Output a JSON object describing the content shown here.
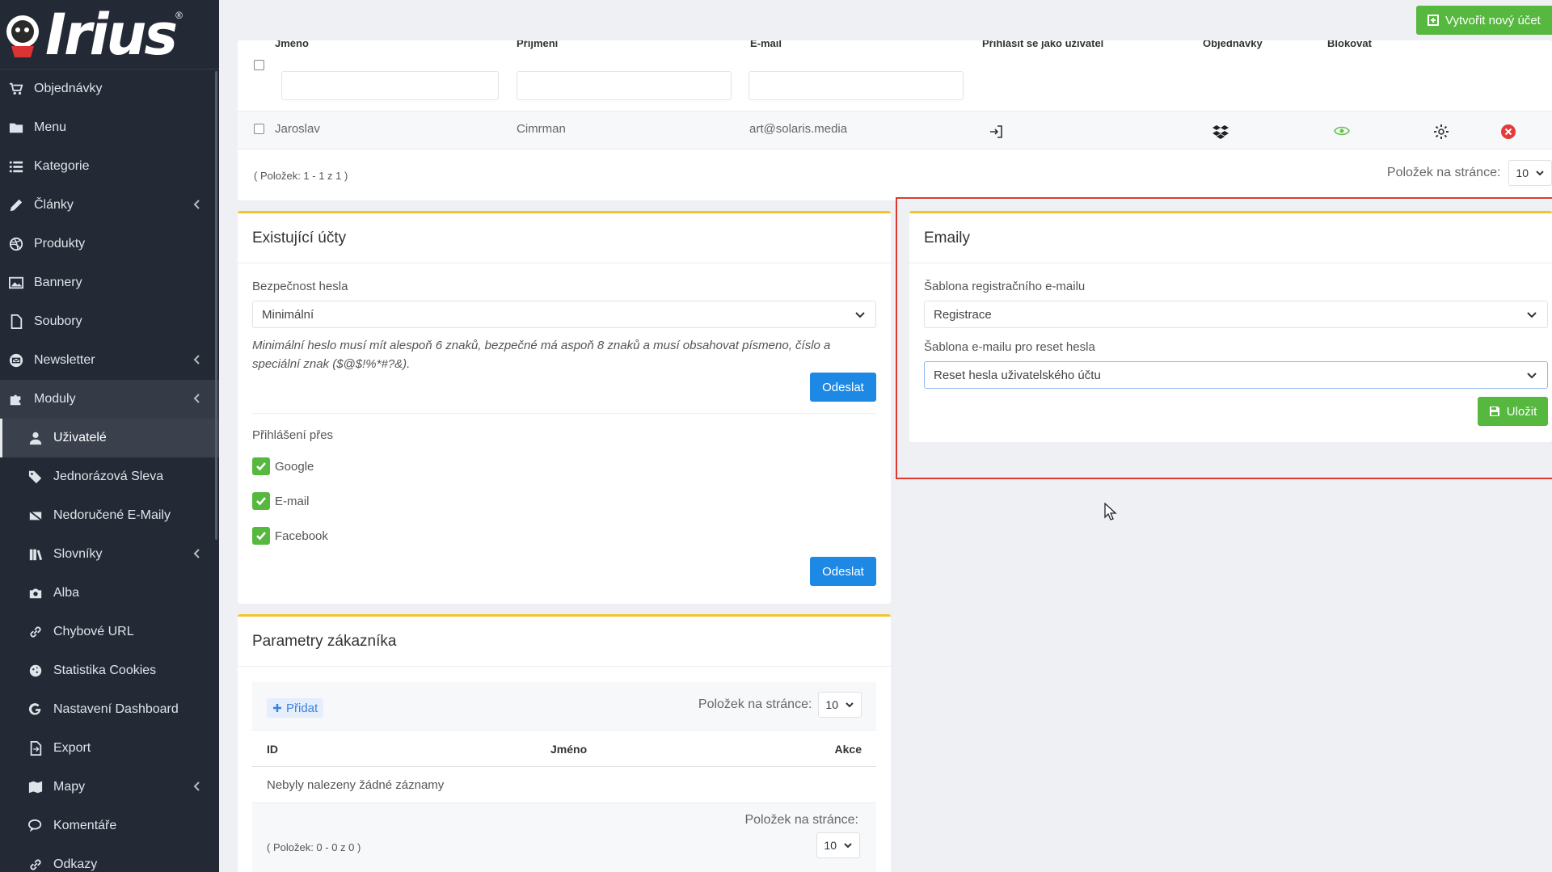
{
  "brand": {
    "name": "Irius",
    "mark": "®"
  },
  "sidebar": {
    "items": [
      {
        "label": "Objednávky",
        "icon": "cart-icon"
      },
      {
        "label": "Menu",
        "icon": "folder-icon"
      },
      {
        "label": "Kategorie",
        "icon": "list-icon"
      },
      {
        "label": "Články",
        "icon": "pencil-icon",
        "chevron": true
      },
      {
        "label": "Produkty",
        "icon": "dribbble-icon"
      },
      {
        "label": "Bannery",
        "icon": "image-icon"
      },
      {
        "label": "Soubory",
        "icon": "file-icon"
      },
      {
        "label": "Newsletter",
        "icon": "mail-icon",
        "chevron": true
      },
      {
        "label": "Moduly",
        "icon": "puzzle-icon",
        "chevron": true
      },
      {
        "label": "Uživatelé",
        "icon": "user-icon"
      },
      {
        "label": "Jednorázová Sleva",
        "icon": "tag-icon"
      },
      {
        "label": "Nedoručené E-Maily",
        "icon": "mail-slash-icon"
      },
      {
        "label": "Slovníky",
        "icon": "books-icon",
        "chevron": true
      },
      {
        "label": "Alba",
        "icon": "camera-icon"
      },
      {
        "label": "Chybové URL",
        "icon": "link-icon"
      },
      {
        "label": "Statistika Cookies",
        "icon": "cookie-icon"
      },
      {
        "label": "Nastavení Dashboard",
        "icon": "google-icon"
      },
      {
        "label": "Export",
        "icon": "export-icon"
      },
      {
        "label": "Mapy",
        "icon": "map-icon",
        "chevron": true
      },
      {
        "label": "Komentáře",
        "icon": "comments-icon"
      },
      {
        "label": "Odkazy",
        "icon": "link-icon"
      }
    ]
  },
  "topbar": {
    "create_label": "Vytvořit nový účet"
  },
  "users_table": {
    "headers": [
      "Jméno",
      "Příjmení",
      "E-mail",
      "Přihlásit se jako uživatel",
      "Objednávky",
      "Blokovat"
    ],
    "rows": [
      {
        "first": "Jaroslav",
        "last": "Cimrman",
        "email": "art@solaris.media"
      }
    ],
    "info": "( Položek: 1 - 1 z 1 )",
    "per_page_label": "Položek na stránce:",
    "per_page_value": "10"
  },
  "accounts": {
    "title": "Existující účty",
    "password_label": "Bezpečnost hesla",
    "password_value": "Minimální",
    "password_hint": "Minimální heslo musí mít alespoň 6 znaků, bezpečné má aspoň 8 znaků a musí obsahovat písmeno, číslo a speciální znak ($@$!%*#?&).",
    "submit_label": "Odeslat",
    "login_label": "Přihlášení přes",
    "login_options": [
      "Google",
      "E-mail",
      "Facebook"
    ],
    "submit2_label": "Odeslat"
  },
  "emails": {
    "title": "Emaily",
    "reg_label": "Šablona registračního e-mailu",
    "reg_value": "Registrace",
    "reset_label": "Šablona e-mailu pro reset hesla",
    "reset_value": "Reset hesla uživatelského účtu",
    "save_label": "Uložit"
  },
  "params": {
    "title": "Parametry zákazníka",
    "add_label": "Přidat",
    "per_page_label": "Položek na stránce:",
    "per_page_value": "10",
    "headers": [
      "ID",
      "Jméno",
      "Akce"
    ],
    "empty": "Nebyly nalezeny žádné záznamy",
    "info": "( Položek: 0 - 0 z 0 )",
    "per_page_label2": "Položek na stránce:",
    "per_page_value2": "10"
  }
}
